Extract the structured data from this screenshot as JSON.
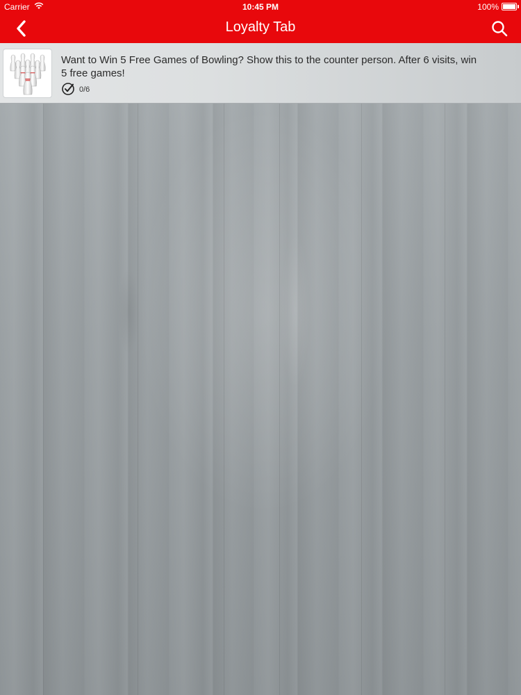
{
  "status_bar": {
    "carrier": "Carrier",
    "time": "10:45 PM",
    "battery": "100%",
    "battery_level": 1.0
  },
  "nav": {
    "title": "Loyalty Tab",
    "back_icon": "chevron-left-icon",
    "search_icon": "search-icon"
  },
  "loyalty_card": {
    "image": "bowling-pins-icon",
    "message": "Want to Win 5 Free Games of Bowling? Show this to the counter person. After 6 visits, win 5 free games!",
    "progress_text": "0/6",
    "visits_done": 0,
    "visits_required": 6
  },
  "colors": {
    "accent": "#e8080c",
    "background": "#9aa0a3"
  }
}
